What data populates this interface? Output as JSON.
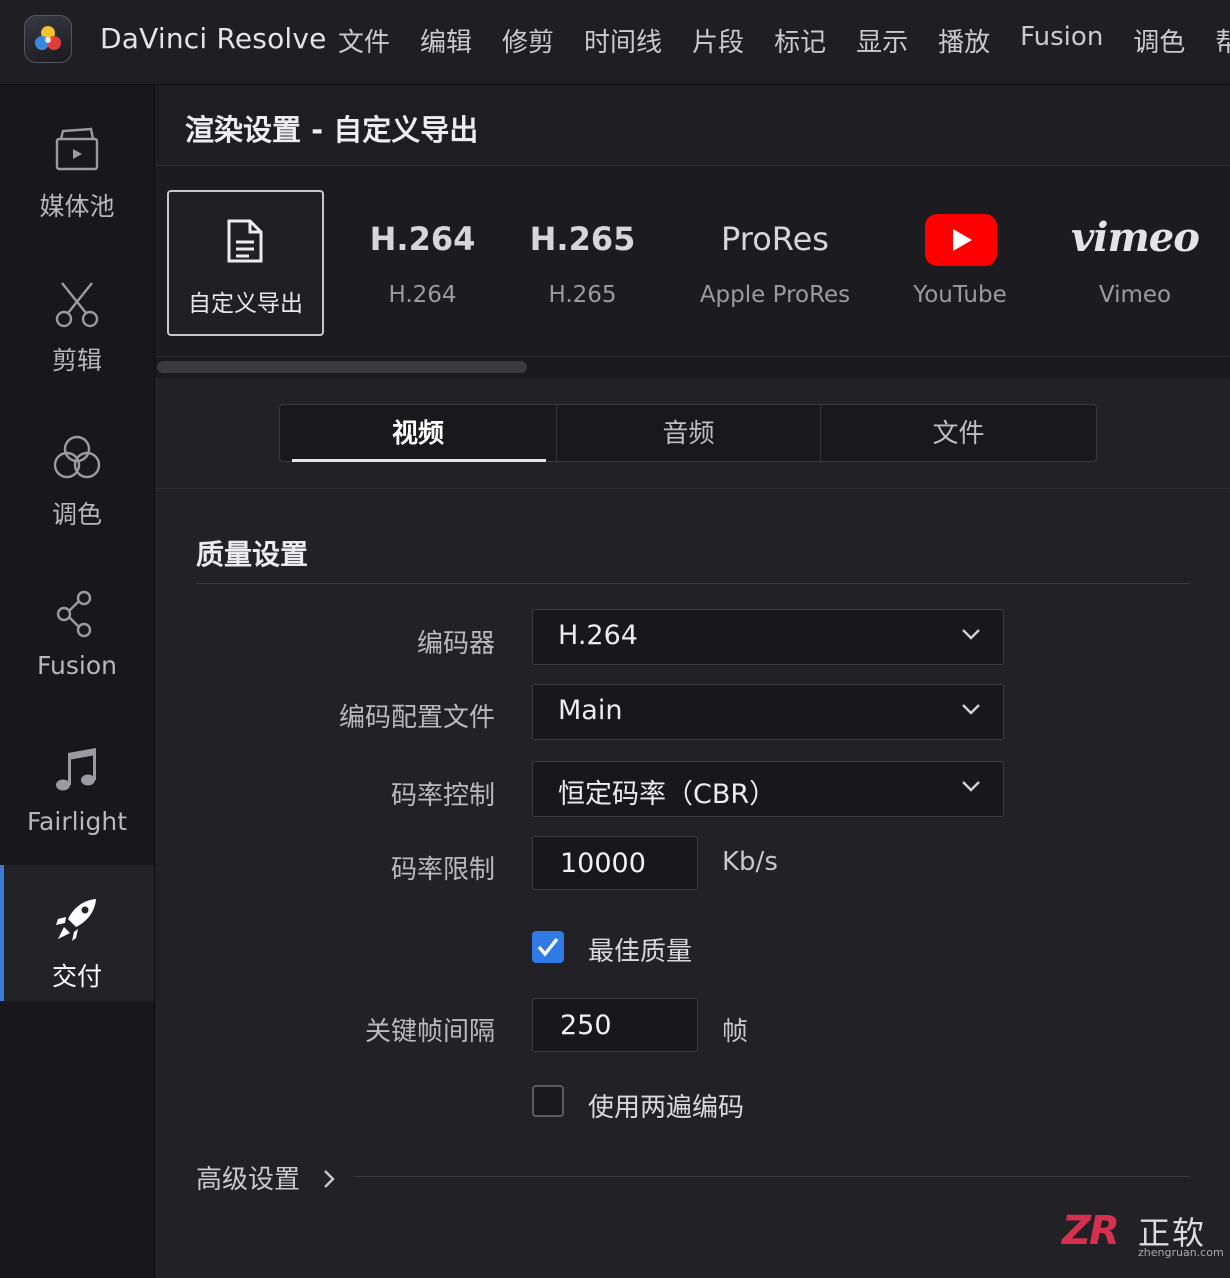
{
  "app": {
    "name": "DaVinci Resolve",
    "menu": [
      "文件",
      "编辑",
      "修剪",
      "时间线",
      "片段",
      "标记",
      "显示",
      "播放",
      "Fusion",
      "调色",
      "帮助"
    ]
  },
  "sidebar": {
    "pages": [
      {
        "label": "媒体池",
        "icon": "media-pool-icon"
      },
      {
        "label": "剪辑",
        "icon": "scissors-icon"
      },
      {
        "label": "调色",
        "icon": "color-wheels-icon"
      },
      {
        "label": "Fusion",
        "icon": "fusion-nodes-icon"
      },
      {
        "label": "Fairlight",
        "icon": "music-note-icon"
      },
      {
        "label": "交付",
        "icon": "rocket-icon",
        "active": true
      }
    ]
  },
  "panel": {
    "title": "渲染设置 - 自定义导出"
  },
  "presets": [
    {
      "big": "",
      "sub": "自定义导出",
      "icon": "document-icon",
      "selected": true
    },
    {
      "big": "H.264",
      "sub": "H.264"
    },
    {
      "big": "H.265",
      "sub": "H.265"
    },
    {
      "big": "ProRes",
      "sub": "Apple ProRes"
    },
    {
      "big": "",
      "sub": "YouTube",
      "icon": "youtube-icon"
    },
    {
      "big": "vimeo",
      "sub": "Vimeo",
      "icon": "vimeo-logo"
    }
  ],
  "tabs": [
    {
      "label": "视频",
      "active": true
    },
    {
      "label": "音频"
    },
    {
      "label": "文件"
    }
  ],
  "quality": {
    "section_title": "质量设置",
    "codec_label": "编码器",
    "codec_value": "H.264",
    "profile_label": "编码配置文件",
    "profile_value": "Main",
    "rate_control_label": "码率控制",
    "rate_control_value": "恒定码率（CBR）",
    "bitrate_label": "码率限制",
    "bitrate_value": "10000",
    "bitrate_unit": "Kb/s",
    "best_quality_label": "最佳质量",
    "best_quality_checked": true,
    "keyframe_label": "关键帧间隔",
    "keyframe_value": "250",
    "keyframe_unit": "帧",
    "two_pass_label": "使用两遍编码",
    "two_pass_checked": false,
    "advanced_label": "高级设置"
  },
  "watermark": {
    "logo": "ZR",
    "brand": "正软",
    "url": "zhengruan.com"
  },
  "colors": {
    "accent": "#2f7ae5",
    "youtube_red": "#ff0000",
    "background": "#222226"
  }
}
